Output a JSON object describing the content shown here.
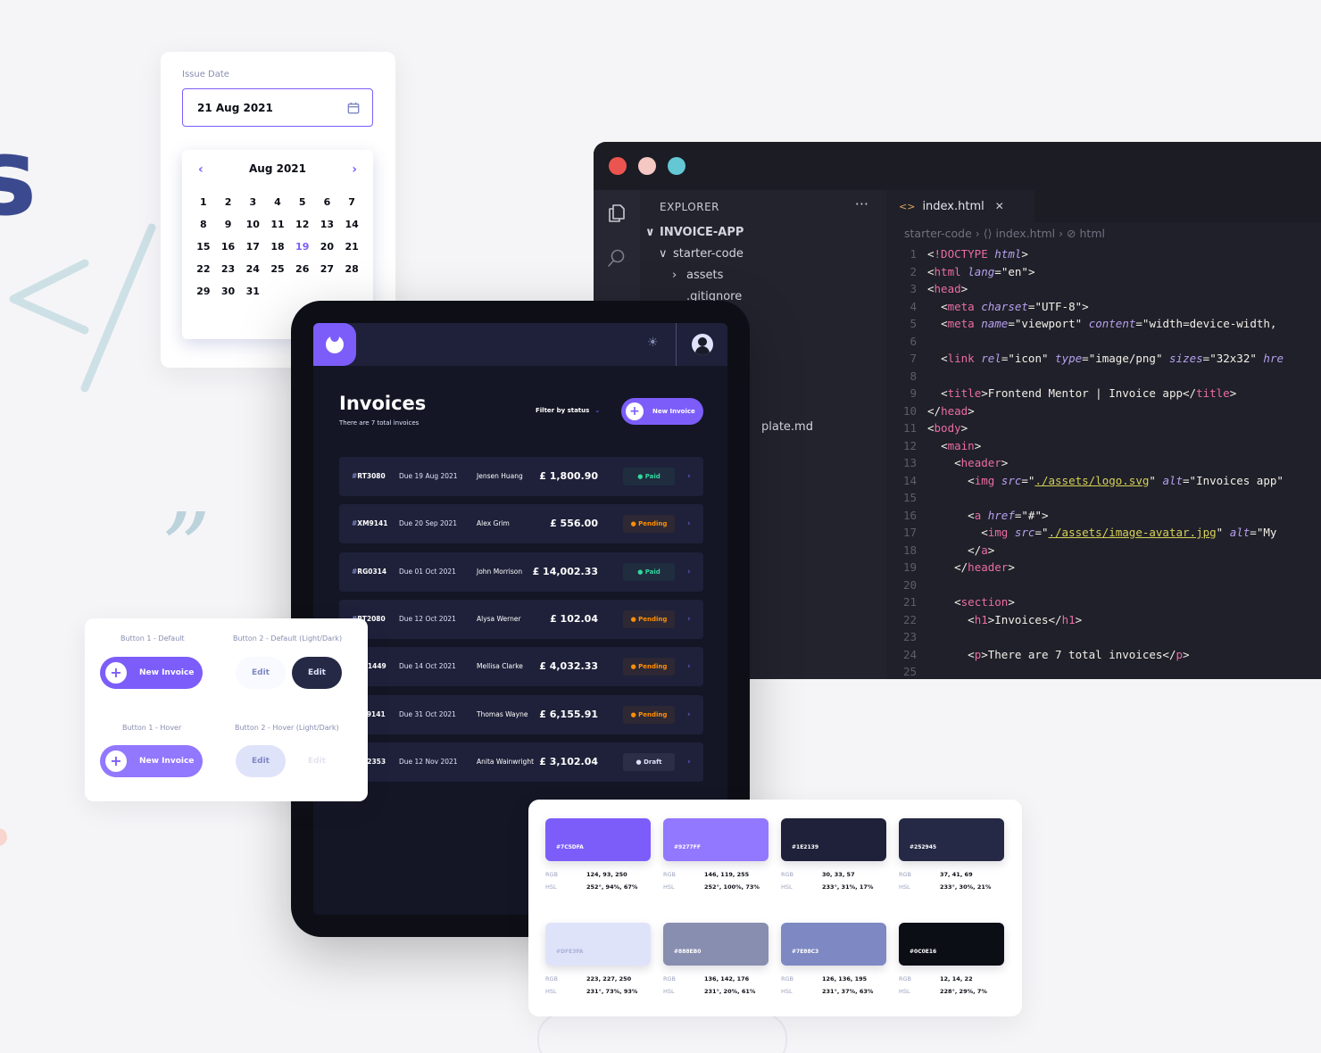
{
  "date_picker": {
    "label": "Issue Date",
    "value": "21 Aug 2021",
    "month": "Aug 2021",
    "selected_day": "19",
    "days": [
      "1",
      "2",
      "3",
      "4",
      "5",
      "6",
      "7",
      "8",
      "9",
      "10",
      "11",
      "12",
      "13",
      "14",
      "15",
      "16",
      "17",
      "18",
      "19",
      "20",
      "21",
      "22",
      "23",
      "24",
      "25",
      "26",
      "27",
      "28",
      "29",
      "30",
      "31"
    ]
  },
  "editor": {
    "explorer_title": "EXPLORER",
    "explorer_more": "···",
    "tree": [
      {
        "label": "INVOICE-APP",
        "chev": "∨",
        "indent": 0,
        "bold": true
      },
      {
        "label": "starter-code",
        "chev": "∨",
        "indent": 1,
        "bold": false
      },
      {
        "label": "assets",
        "chev": "›",
        "indent": 2,
        "bold": false
      },
      {
        "label": ".gitignore",
        "chev": "",
        "indent": 2,
        "bold": false
      },
      {
        "label": "plate.md",
        "chev": "",
        "indent": 2,
        "bold": false
      }
    ],
    "tab_label": "index.html",
    "tab_close": "✕",
    "breadcrumb": "starter-code  ›  ⟨⟩ index.html  ›  ⊘ html",
    "lines": [
      "<!DOCTYPE html>",
      "<html lang=\"en\">",
      "<head>",
      "  <meta charset=\"UTF-8\">",
      "  <meta name=\"viewport\" content=\"width=device-width,",
      "",
      "  <link rel=\"icon\" type=\"image/png\" sizes=\"32x32\" hre",
      "",
      "  <title>Frontend Mentor | Invoice app</title>",
      "</head>",
      "<body>",
      "  <main>",
      "    <header>",
      "      <img src=\"./assets/logo.svg\" alt=\"Invoices app\"",
      "",
      "      <a href=\"#\">",
      "        <img src=\"./assets/image-avatar.jpg\" alt=\"My",
      "      </a>",
      "    </header>",
      "",
      "    <section>",
      "      <h1>Invoices</h1>",
      "",
      "      <p>There are 7 total invoices</p>",
      ""
    ]
  },
  "tablet": {
    "title": "Invoices",
    "subtitle": "There are 7 total invoices",
    "filter_label": "Filter by status",
    "new_button": "New Invoice",
    "invoices": [
      {
        "id": "RT3080",
        "due": "Due 19 Aug 2021",
        "name": "Jensen Huang",
        "amount": "£ 1,800.90",
        "status": "Paid"
      },
      {
        "id": "XM9141",
        "due": "Due 20 Sep 2021",
        "name": "Alex Grim",
        "amount": "£ 556.00",
        "status": "Pending"
      },
      {
        "id": "RG0314",
        "due": "Due 01 Oct 2021",
        "name": "John Morrison",
        "amount": "£ 14,002.33",
        "status": "Paid"
      },
      {
        "id": "RT2080",
        "due": "Due 12 Oct 2021",
        "name": "Alysa Werner",
        "amount": "£ 102.04",
        "status": "Pending"
      },
      {
        "id": "AA1449",
        "due": "Due 14 Oct 2021",
        "name": "Mellisa Clarke",
        "amount": "£ 4,032.33",
        "status": "Pending"
      },
      {
        "id": "TY9141",
        "due": "Due 31 Oct 2021",
        "name": "Thomas Wayne",
        "amount": "£ 6,155.91",
        "status": "Pending"
      },
      {
        "id": "FV2353",
        "due": "Due 12 Nov 2021",
        "name": "Anita Wainwright",
        "amount": "£ 3,102.04",
        "status": "Draft"
      }
    ]
  },
  "buttons": {
    "cap1": "Button 1 - Default",
    "cap2": "Button 2 - Default (Light/Dark)",
    "cap3": "Button 1 - Hover",
    "cap4": "Button 2 - Hover (Light/Dark)",
    "new_invoice": "New Invoice",
    "edit": "Edit"
  },
  "palette": [
    {
      "hex": "#7C5DFA",
      "rgb": "124, 93, 250",
      "hsl": "252°, 94%, 67%",
      "color": "#7c5dfa"
    },
    {
      "hex": "#9277FF",
      "rgb": "146, 119, 255",
      "hsl": "252°, 100%, 73%",
      "color": "#9277ff"
    },
    {
      "hex": "#1E2139",
      "rgb": "30, 33, 57",
      "hsl": "233°, 31%, 17%",
      "color": "#1e2139"
    },
    {
      "hex": "#252945",
      "rgb": "37, 41, 69",
      "hsl": "233°, 30%, 21%",
      "color": "#252945"
    },
    {
      "hex": "#DFE3FA",
      "rgb": "223, 227, 250",
      "hsl": "231°, 73%, 93%",
      "color": "#dfe3fa"
    },
    {
      "hex": "#888EB0",
      "rgb": "136, 142, 176",
      "hsl": "231°, 20%, 61%",
      "color": "#888eb0"
    },
    {
      "hex": "#7E88C3",
      "rgb": "126, 136, 195",
      "hsl": "231°, 37%, 63%",
      "color": "#7e88c3"
    },
    {
      "hex": "#0C0E16",
      "rgb": "12, 14, 22",
      "hsl": "228°, 29%, 7%",
      "color": "#0c0e16"
    }
  ],
  "palette_keys": {
    "rgb": "RGB",
    "hsl": "HSL"
  },
  "colors": {
    "accent": "#7c5dfa",
    "paid": "#33d69f",
    "pending": "#ff8f00",
    "dark": "#141625"
  },
  "icons": [
    "calendar-icon",
    "files-icon",
    "search-icon",
    "sun-icon",
    "avatar",
    "plus-icon",
    "chevron-right-icon"
  ]
}
